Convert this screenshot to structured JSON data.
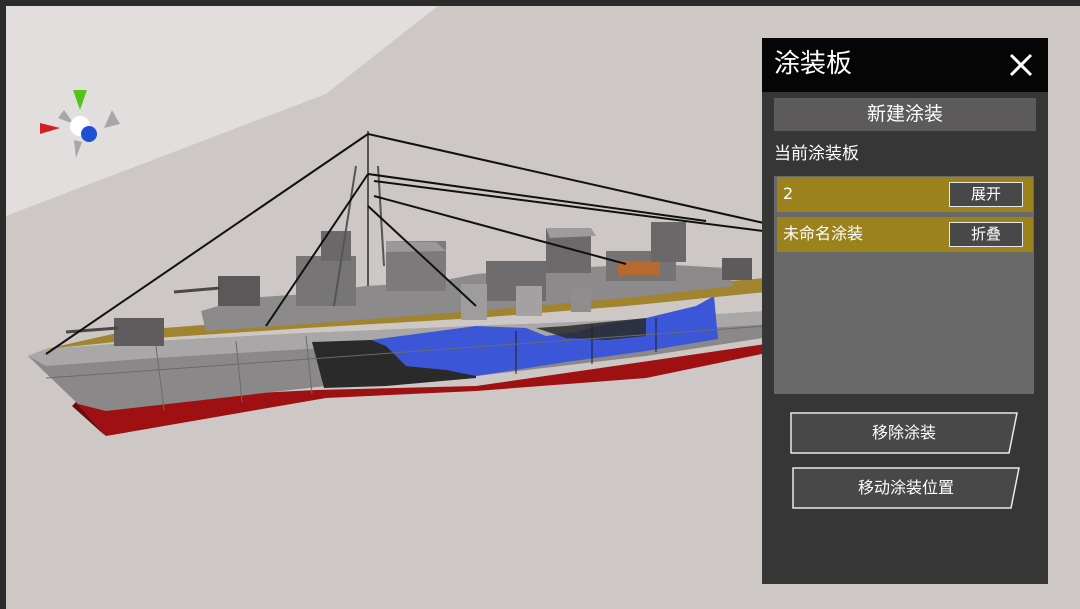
{
  "panel": {
    "title": "涂装板",
    "close_icon": "close-icon",
    "new_paint_label": "新建涂装",
    "current_board_label": "当前涂装板",
    "entries": [
      {
        "label": "2",
        "button_label": "展开"
      },
      {
        "label": "未命名涂装",
        "button_label": "折叠"
      }
    ],
    "remove_label": "移除涂装",
    "move_label": "移动涂装位置"
  },
  "scene": {
    "gizmo_icon": "axis-gizmo-icon",
    "model": "ship-model",
    "colors": {
      "background": "#cdc7c6",
      "hull_gray": "#888686",
      "camo_blue": "#3c56d8",
      "camo_black": "#2a2a2a",
      "waterline_red": "#9e1012",
      "panel_bg": "#363636",
      "panel_header": "#050505",
      "row_gold": "#9b821d"
    }
  }
}
